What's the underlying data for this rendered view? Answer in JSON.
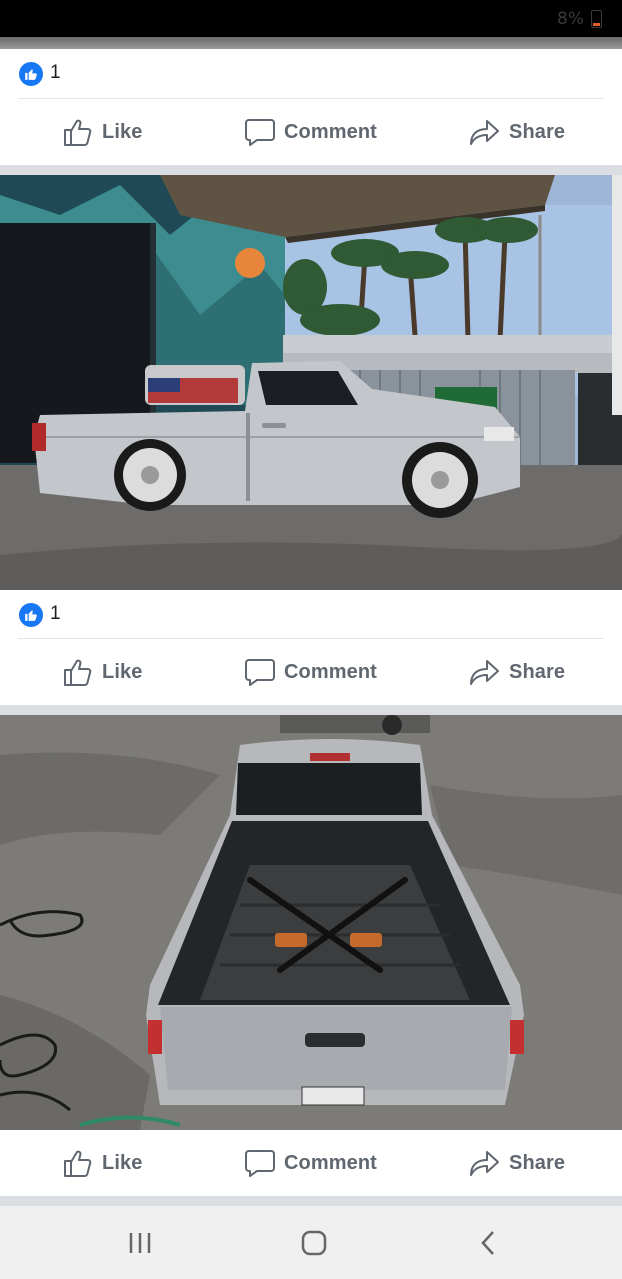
{
  "status_bar": {
    "battery": "8%"
  },
  "posts": [
    {
      "reaction_count": "1"
    },
    {
      "reaction_count": "1"
    },
    {
      "reaction_count": ""
    }
  ],
  "actions": {
    "like": "Like",
    "comment": "Comment",
    "share": "Share"
  },
  "icons": {
    "reaction": "like-reaction-icon",
    "like": "thumbs-up-icon",
    "comment": "speech-bubble-icon",
    "share": "share-arrow-icon",
    "nav_recent": "recent-apps-icon",
    "nav_home": "home-icon",
    "nav_back": "back-icon"
  },
  "colors": {
    "facebook_blue": "#1877f2",
    "action_gray": "#606770",
    "feed_bg": "#dadde1"
  }
}
